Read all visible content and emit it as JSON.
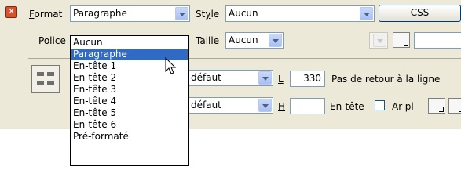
{
  "row1": {
    "format_label": "Format",
    "format_value": "Paragraphe",
    "style_label": "Style",
    "style_value": "Aucun",
    "css_button": "CSS"
  },
  "row2": {
    "font_label": "Police",
    "size_label": "Taille",
    "size_value": "Aucun"
  },
  "row3": {
    "horiz_value": "défaut",
    "width_label": "L",
    "width_value": "330",
    "nowrap_label": "Pas de retour à la ligne"
  },
  "row4": {
    "vert_value": "défaut",
    "height_label": "H",
    "height_value": "",
    "header_label": "En-tête",
    "bg_label": "Ar-pl"
  },
  "format_dropdown": {
    "items": [
      "Aucun",
      "Paragraphe",
      "En-tête 1",
      "En-tête 2",
      "En-tête 3",
      "En-tête 4",
      "En-tête 5",
      "En-tête 6",
      "Pré-formaté"
    ],
    "selected_index": 1
  },
  "colors": {
    "panel": "#ece9d8",
    "selection": "#316ac5",
    "field_border": "#7f9db9"
  }
}
